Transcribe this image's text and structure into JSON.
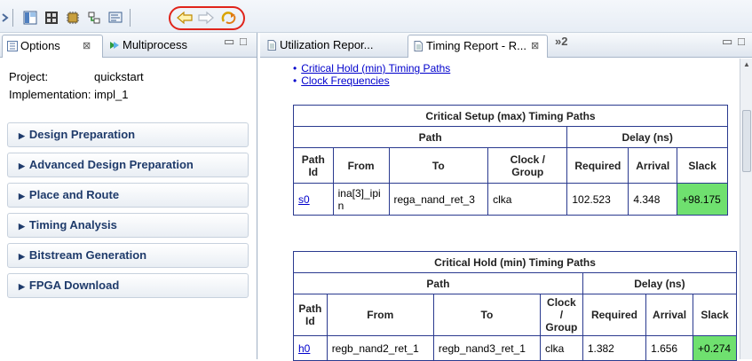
{
  "left_panel": {
    "tabs": [
      {
        "label": "Options",
        "close": "⊠"
      },
      {
        "label": "Multiprocess"
      }
    ],
    "project_label": "Project:",
    "project_value": "quickstart",
    "implementation_label": "Implementation:",
    "implementation_value": "impl_1",
    "sections": [
      "Design Preparation",
      "Advanced Design Preparation",
      "Place and Route",
      "Timing Analysis",
      "Bitstream Generation",
      "FPGA Download"
    ]
  },
  "right_panel": {
    "tabs": [
      {
        "label": "Utilization Repor..."
      },
      {
        "label": "Timing Report - R...",
        "close": "⊠"
      },
      {
        "label": "»2"
      }
    ],
    "links": [
      "Critical Hold (min) Timing Paths",
      "Clock Frequencies"
    ],
    "setup_table": {
      "title": "Critical Setup (max) Timing Paths",
      "group_path": "Path",
      "group_delay": "Delay (ns)",
      "headers": [
        "Path Id",
        "From",
        "To",
        "Clock / Group",
        "Required",
        "Arrival",
        "Slack"
      ],
      "row": {
        "id": "s0",
        "from": "ina[3]_ipin",
        "to": "rega_nand_ret_3",
        "clock": "clka",
        "required": "102.523",
        "arrival": "4.348",
        "slack": "+98.175"
      }
    },
    "hold_table": {
      "title": "Critical Hold (min) Timing Paths",
      "group_path": "Path",
      "group_delay": "Delay (ns)",
      "headers": [
        "Path Id",
        "From",
        "To",
        "Clock / Group",
        "Required",
        "Arrival",
        "Slack"
      ],
      "row": {
        "id": "h0",
        "from": "regb_nand2_ret_1",
        "to": "regb_nand3_ret_1",
        "clock": "clka",
        "required": "1.382",
        "arrival": "1.656",
        "slack": "+0.274"
      }
    }
  },
  "colors": {
    "slack_bg": "#6fe06f",
    "link": "#0000cc",
    "highlight_circle": "#e0241b",
    "section_text": "#1f3b6b"
  }
}
